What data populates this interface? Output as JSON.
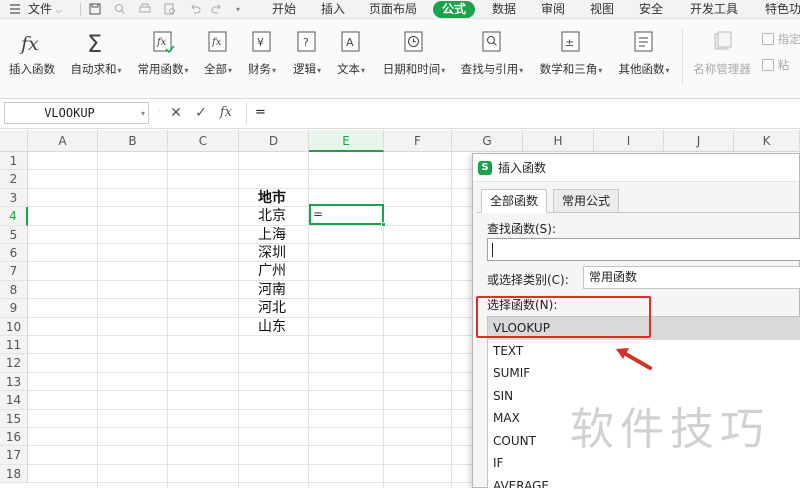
{
  "menu": {
    "file": "文件",
    "tabs": [
      "开始",
      "插入",
      "页面布局",
      "公式",
      "数据",
      "审阅",
      "视图",
      "安全",
      "开发工具",
      "特色功"
    ],
    "active_tab": "公式"
  },
  "ribbon": {
    "insert_function": "插入函数",
    "autosum": "自动求和",
    "common": "常用函数",
    "all": "全部",
    "finance": "财务",
    "logic": "逻辑",
    "text": "文本",
    "datetime": "日期和时间",
    "lookup": "查找与引用",
    "math": "数学和三角",
    "other": "其他函数",
    "name_manager": "名称管理器",
    "paste_partial": "粘",
    "specify_partial": "指定"
  },
  "formula_bar": {
    "name_box": "VLOOKUP",
    "cancel": "✕",
    "confirm": "✓",
    "fx": "fx",
    "content": "="
  },
  "sheet": {
    "columns": [
      "A",
      "B",
      "C",
      "D",
      "E",
      "F",
      "G",
      "H",
      "I",
      "J",
      "K"
    ],
    "selected_column": "E",
    "rows": [
      "1",
      "2",
      "3",
      "4",
      "5",
      "6",
      "7",
      "8",
      "9",
      "10",
      "11",
      "12",
      "13",
      "14",
      "15",
      "16",
      "17",
      "18"
    ],
    "selected_row": "4",
    "header_cell": "地市",
    "cities": [
      "北京",
      "上海",
      "深圳",
      "广州",
      "河南",
      "河北",
      "山东"
    ],
    "active_cell_value": "="
  },
  "dialog": {
    "logo": "S",
    "title": "插入函数",
    "tab_all": "全部函数",
    "tab_common": "常用公式",
    "search_label": "查找函数(S):",
    "search_value": "",
    "category_label": "或选择类别(C):",
    "category_value": "常用函数",
    "select_label": "选择函数(N):",
    "functions": [
      "VLOOKUP",
      "TEXT",
      "SUMIF",
      "SIN",
      "MAX",
      "COUNT",
      "IF",
      "AVERAGE"
    ],
    "selected_function": "VLOOKUP"
  },
  "colors": {
    "accent": "#1aa34a",
    "highlight": "#d9302b"
  },
  "watermark": "软件技巧"
}
